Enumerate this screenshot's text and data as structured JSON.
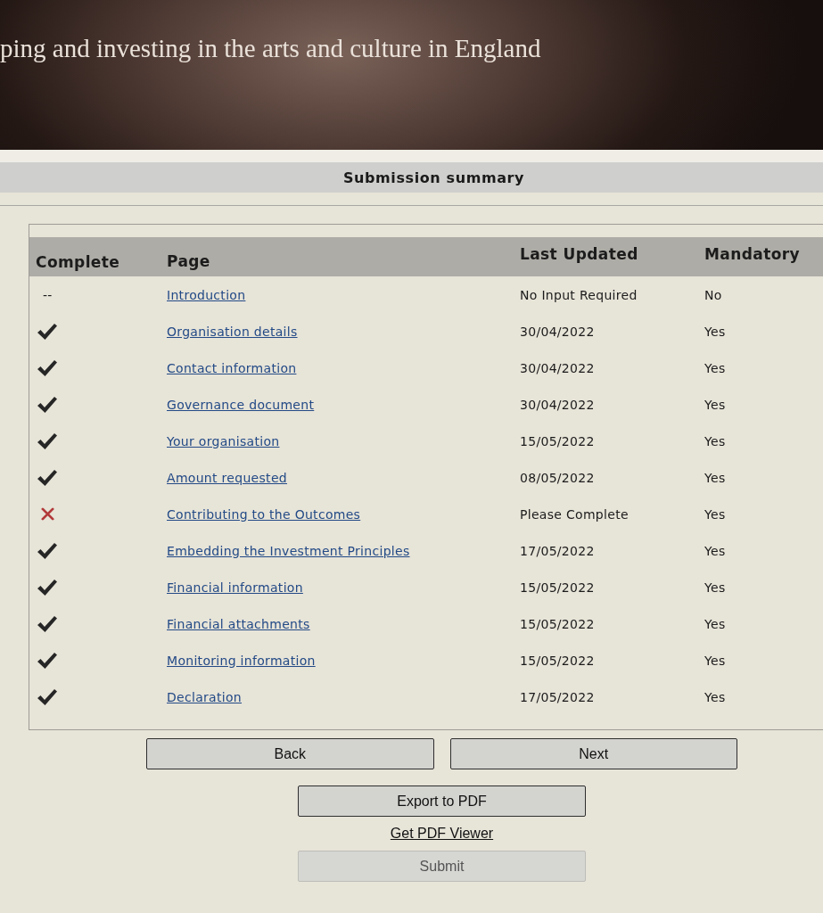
{
  "banner": {
    "tagline": "ping and investing in the arts and culture in England"
  },
  "section": {
    "title": "Submission summary"
  },
  "table": {
    "columns": [
      "Complete",
      "Page",
      "Last Updated",
      "Mandatory"
    ],
    "rows": [
      {
        "kind": "not_required",
        "complete_text": "--",
        "page": "Introduction",
        "last_updated": "No Input Required",
        "mandatory": "No"
      },
      {
        "kind": "complete",
        "page": "Organisation details",
        "last_updated": "30/04/2022",
        "mandatory": "Yes"
      },
      {
        "kind": "complete",
        "page": "Contact information",
        "last_updated": "30/04/2022",
        "mandatory": "Yes"
      },
      {
        "kind": "complete",
        "page": "Governance document",
        "last_updated": "30/04/2022",
        "mandatory": "Yes"
      },
      {
        "kind": "complete",
        "page": "Your organisation",
        "last_updated": "15/05/2022",
        "mandatory": "Yes"
      },
      {
        "kind": "complete",
        "page": "Amount requested",
        "last_updated": "08/05/2022",
        "mandatory": "Yes"
      },
      {
        "kind": "incomplete",
        "page": "Contributing to the Outcomes",
        "last_updated": "Please Complete",
        "mandatory": "Yes"
      },
      {
        "kind": "complete",
        "page": "Embedding the Investment Principles",
        "last_updated": "17/05/2022",
        "mandatory": "Yes"
      },
      {
        "kind": "complete",
        "page": "Financial information",
        "last_updated": "15/05/2022",
        "mandatory": "Yes"
      },
      {
        "kind": "complete",
        "page": "Financial attachments",
        "last_updated": "15/05/2022",
        "mandatory": "Yes"
      },
      {
        "kind": "complete",
        "page": "Monitoring information",
        "last_updated": "15/05/2022",
        "mandatory": "Yes"
      },
      {
        "kind": "complete",
        "page": "Declaration",
        "last_updated": "17/05/2022",
        "mandatory": "Yes"
      }
    ]
  },
  "actions": {
    "nav_buttons": [
      {
        "label": "Back",
        "disabled": false
      },
      {
        "label": "Next",
        "disabled": false
      }
    ],
    "export_button": {
      "label": "Export to PDF",
      "disabled": false
    },
    "pdf_link": "Get PDF Viewer",
    "submit_button": {
      "label": "Submit",
      "disabled": true
    }
  }
}
